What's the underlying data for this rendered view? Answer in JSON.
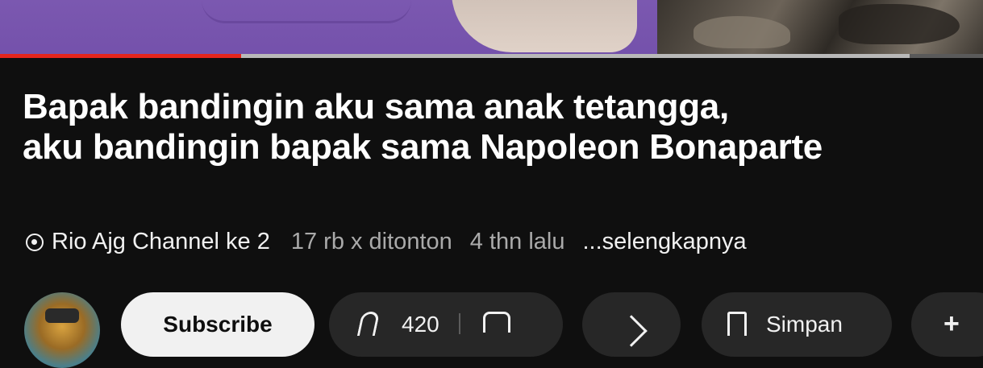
{
  "video": {
    "title_line1": "Bapak bandingin aku sama anak tetangga,",
    "title_line2": "aku bandingin bapak sama Napoleon Bonaparte",
    "playback_progress_fraction": 0.245,
    "buffered_fraction": 0.925
  },
  "meta": {
    "channel_name": "Rio Ajg Channel ke 2",
    "views": "17 rb x ditonton",
    "age": "4 thn lalu",
    "more_link": "...selengkapnya"
  },
  "actions": {
    "subscribe_label": "Subscribe",
    "like_count": "420",
    "save_label": "Simpan",
    "extra_label": "+"
  },
  "colors": {
    "background": "#0f0f0f",
    "progress_played": "#e5251c",
    "pill_bg": "#272727",
    "subscribe_bg": "#f1f1f1"
  },
  "icons": {
    "channel_marker": "live-dot-icon",
    "like": "thumbs-up-icon",
    "dislike": "thumbs-down-icon",
    "share": "share-icon",
    "save": "bookmark-icon"
  }
}
